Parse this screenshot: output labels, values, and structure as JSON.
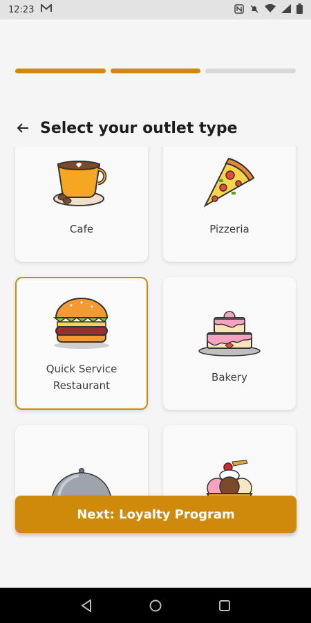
{
  "status": {
    "time": "12:23",
    "carrier_icon": "gmail-icon",
    "battery_label": "battery"
  },
  "progress": {
    "steps_total": 3,
    "steps_completed": 2,
    "accent": "#d08a0b"
  },
  "header": {
    "title": "Select your outlet type"
  },
  "outlet_types": [
    {
      "label": "Cafe",
      "icon": "coffee-cup-icon",
      "selected": false
    },
    {
      "label": "Pizzeria",
      "icon": "pizza-slice-icon",
      "selected": false
    },
    {
      "label": "Quick Service Restaurant",
      "icon": "burger-icon",
      "selected": true
    },
    {
      "label": "Bakery",
      "icon": "cake-icon",
      "selected": false
    },
    {
      "label": "",
      "icon": "cloche-icon",
      "selected": false
    },
    {
      "label": "",
      "icon": "ice-cream-sundae-icon",
      "selected": false
    }
  ],
  "footer": {
    "next_label": "Next: Loyalty Program"
  }
}
